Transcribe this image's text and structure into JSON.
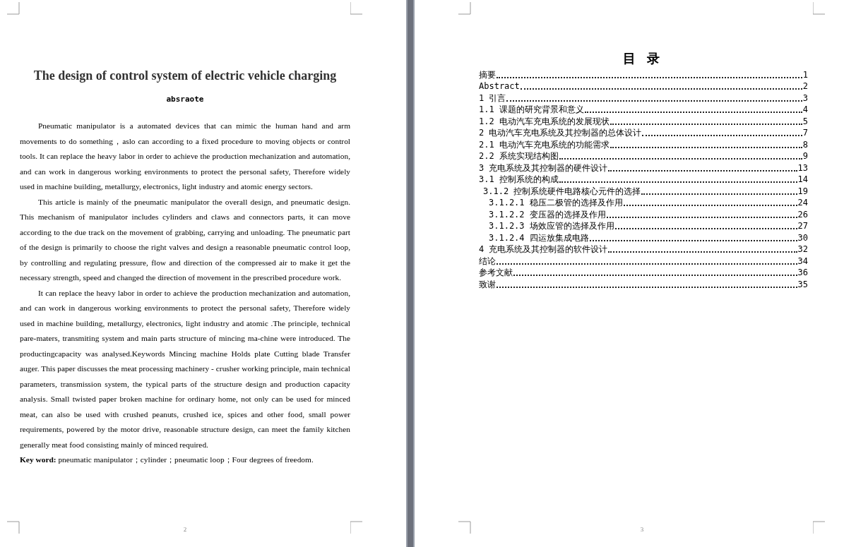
{
  "left_page": {
    "title": "The design of control system of electric vehicle charging",
    "subtitle": "absraote",
    "paragraphs": [
      "Pneumatic manipulator is a automated devices that can mimic the human hand and arm movements to do something，aslo can according to a fixed procedure to moving objects or control tools. It can replace the heavy labor in order to achieve the production mechanization and automation, and can work in dangerous working environments to protect the personal safety, Therefore widely used in machine building, metallurgy, electronics, light industry and atomic energy sectors.",
      "This article is mainly of the pneumatic manipulator the overall design, and pneumatic design. This mechanism of manipulator includes cylinders and claws and connectors parts, it can move according to the due track on the movement of grabbing, carrying and unloading. The pneumatic part of the design is primarily to choose the right valves and design a reasonable pneumatic control loop, by controlling and regulating pressure, flow and direction of the compressed air to make it get the necessary strength, speed and changed the direction of movement in the prescribed procedure work.",
      "It can replace the heavy labor in order to achieve the production mechanization and automation, and can work in dangerous working environments to protect the personal safety, Therefore widely used in machine building, metallurgy, electronics, light industry and atomic .The principle, technical pare-maters, transmiting system and main parts structure of mincing ma-chine were introduced. The productingcapacity was analysed.Keywords Mincing machine Holds plate Cutting blade Transfer auger. This paper discusses the meat processing machinery - crusher working principle, main technical parameters, transmission system, the typical parts of the structure design and production capacity analysis. Small twisted paper broken machine for ordinary home, not only can be used for minced meat, can also be used with crushed peanuts, crushed ice, spices and other food, small power requirements, powered by the motor drive, reasonable structure design, can meet the family kitchen generally meat food consisting mainly of minced required."
    ],
    "keywords": "**Key word:** pneumatic manipulator；cylinder；pneumatic loop；Four degrees of freedom.",
    "page_number": "2"
  },
  "right_page": {
    "title": "目 录",
    "toc": [
      {
        "label": "摘要",
        "page": "1"
      },
      {
        "label": "Abstract",
        "page": "2"
      },
      {
        "label": "1 引言",
        "page": "3",
        "children": [
          {
            "label": "1.1 课题的研究背景和意义",
            "page": "4"
          },
          {
            "label": "1.2 电动汽车充电系统的发展现状",
            "page": "5"
          }
        ]
      },
      {
        "label": "2 电动汽车充电系统及其控制器的总体设计",
        "page": "7",
        "children": [
          {
            "label": "2.1 电动汽车充电系统的功能需求",
            "page": "8"
          },
          {
            "label": "2.2 系统实现结构图",
            "page": "9"
          }
        ]
      },
      {
        "label": "3 充电系统及其控制器的硬件设计",
        "page": "13",
        "children": [
          {
            "label": "3.1 控制系统的构成",
            "page": "14",
            "children": [
              {
                "label": "3.1.2 控制系统硬件电路核心元件的选择",
                "page": "19",
                "children": [
                  {
                    "label": "3.1.2.1 稳压二极管的选择及作用",
                    "page": "24"
                  },
                  {
                    "label": "3.1.2.2 变压器的选择及作用",
                    "page": "26"
                  },
                  {
                    "label": "3.1.2.3 场效应管的选择及作用",
                    "page": "27"
                  },
                  {
                    "label": "3.1.2.4 四运放集成电路",
                    "page": "30"
                  }
                ]
              }
            ]
          }
        ]
      },
      {
        "label": "4 充电系统及其控制器的软件设计",
        "page": "32"
      },
      {
        "label": "结论",
        "page": "34"
      },
      {
        "label": "参考文献",
        "page": "36"
      },
      {
        "label": "致谢",
        "page": "35"
      }
    ],
    "page_number": "3"
  }
}
